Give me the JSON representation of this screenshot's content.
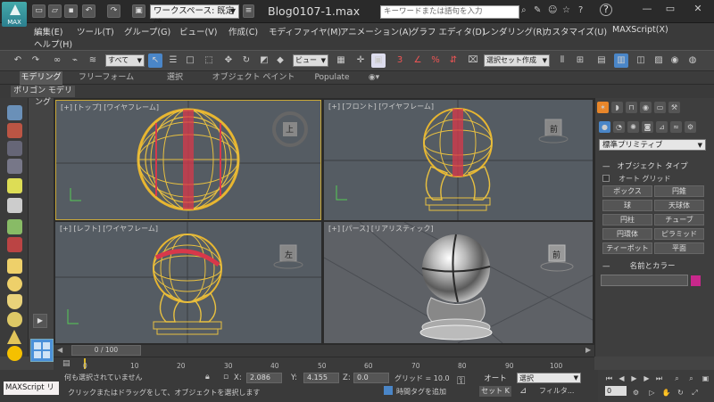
{
  "titlebar": {
    "logo_label": "MAX",
    "workspace": "ワークスペース: 既定値",
    "document_title": "Blog0107-1.max",
    "search_placeholder": "キーワードまたは語句を入力"
  },
  "menu": [
    "編集(E)",
    "ツール(T)",
    "グループ(G)",
    "ビュー(V)",
    "作成(C)",
    "モディファイヤ(M)",
    "アニメーション(A)",
    "グラフ エディタ(D)",
    "レンダリング(R)",
    "カスタマイズ(U)",
    "MAXScript(X)",
    "ヘルプ(H)"
  ],
  "toolbar": {
    "selection_filter": "すべて",
    "ref_coord": "ビュー",
    "named_selection": "選択セット作成"
  },
  "ribbon": {
    "tabs": [
      "モデリング",
      "フリーフォーム",
      "選択",
      "オブジェクト ペイント",
      "Populate"
    ],
    "polygon_modeling": "ポリゴン モデリング"
  },
  "viewports": {
    "top_label": "[+] [トップ] [ワイヤフレーム]",
    "front_label": "[+] [フロント] [ワイヤフレーム]",
    "left_label": "[+] [レフト] [ワイヤフレーム]",
    "persp_label": "[+] [パース] [リアリスティック]",
    "cube_top": "上",
    "cube_front": "前",
    "cube_left": "左",
    "cube_persp": "前"
  },
  "command_panel": {
    "category": "標準プリミティブ",
    "object_type_header": "オブジェクト タイプ",
    "autogrid": "オート グリッド",
    "buttons": [
      "ボックス",
      "円錐",
      "球",
      "天球体",
      "円柱",
      "チューブ",
      "円環体",
      "ピラミッド",
      "ティーポット",
      "平面"
    ],
    "name_color_header": "名前とカラー",
    "name_color_swatch": "#c8288c"
  },
  "timeline": {
    "slider": "0 / 100",
    "ticks": [
      "0",
      "10",
      "20",
      "30",
      "40",
      "50",
      "60",
      "70",
      "80",
      "90",
      "100"
    ]
  },
  "status": {
    "maxscript": "MAXScript リ",
    "selection": "何も選択されていません",
    "prompt": "クリックまたはドラッグをして、オブジェクトを選択します",
    "x_label": "X:",
    "x_value": "2.086",
    "y_label": "Y:",
    "y_value": "4.155",
    "z_label": "Z:",
    "z_value": "0.0",
    "grid": "グリッド = 10.0",
    "time_tag": "時間タグを追加",
    "auto_key": "オート",
    "set_key": "セット K",
    "key_mode": "選択",
    "filter": "フィルタ...",
    "frame": "0"
  }
}
